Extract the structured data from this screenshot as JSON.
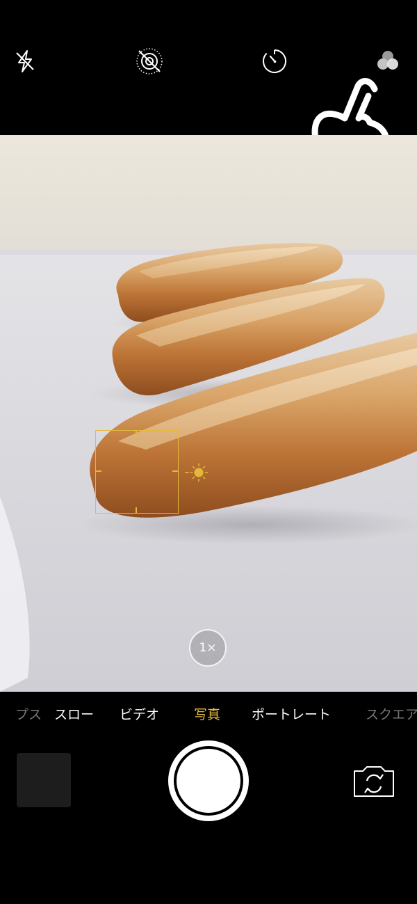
{
  "top_bar": {
    "icons": [
      "flash-off-icon",
      "live-photo-off-icon",
      "timer-icon",
      "filters-icon"
    ]
  },
  "viewfinder": {
    "subject": "baguette rolls",
    "focus_color": "#e4b93a",
    "zoom_label": "1×"
  },
  "modes": {
    "items": [
      "プス",
      "スロー",
      "ビデオ",
      "写真",
      "ポートレート",
      "スクエア"
    ],
    "active": "写真"
  },
  "controls": {
    "shutter": "shutter-button",
    "flip": "switch-camera-icon",
    "thumbnail": "last-photo-thumbnail"
  },
  "colors": {
    "accent": "#e4b93a",
    "background": "#000000"
  }
}
